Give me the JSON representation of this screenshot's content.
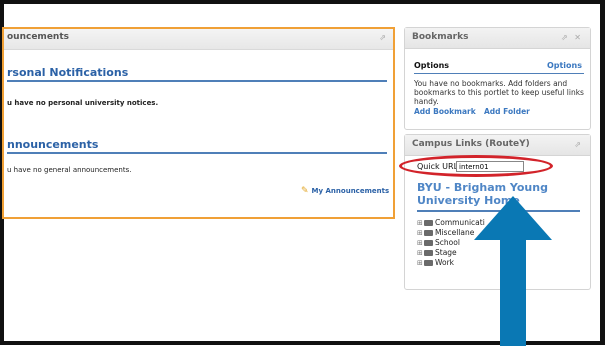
{
  "announcements": {
    "title": "ouncements",
    "personal_heading": "rsonal Notifications",
    "personal_text": "u have no personal university notices.",
    "general_heading": "nnouncements",
    "general_text": "u have no general announcements.",
    "my_link": "My Announcements"
  },
  "bookmarks": {
    "title": "Bookmarks",
    "controls": "⇗ ✕",
    "options_label": "Options",
    "options_link": "Options",
    "message": "You have no bookmarks. Add folders and bookmarks to this portlet to keep useful links handy.",
    "add_bookmark": "Add Bookmark",
    "add_folder": "Add Folder"
  },
  "campus_links": {
    "title": "Campus Links (RouteY)",
    "controls": "⇗",
    "quick_url_label": "Quick URL",
    "quick_url_value": "intern01",
    "home_link": "BYU - Brigham Young University Home",
    "tree": [
      "Communicati",
      "Miscellane",
      "School",
      "Stage",
      "Work"
    ]
  },
  "colors": {
    "highlight_oval": "#d2232a",
    "arrow": "#0a78b4",
    "portlet_border_active": "#f0a036",
    "link": "#3b78c0"
  }
}
